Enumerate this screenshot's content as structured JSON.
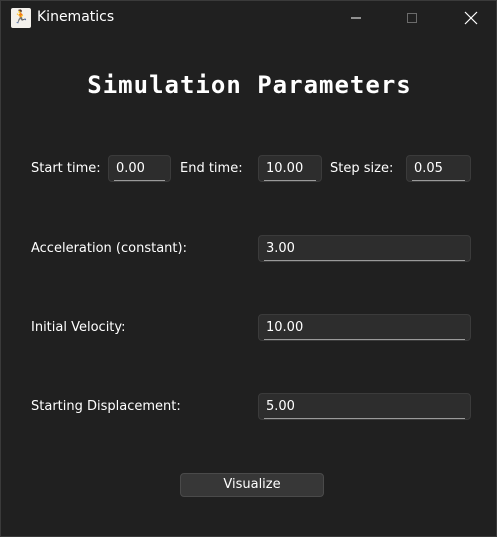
{
  "window": {
    "title": "Kinematics",
    "icon": "running-figure-icon"
  },
  "heading": "Simulation Parameters",
  "time": {
    "start_label": "Start time:",
    "start_value": "0.00",
    "end_label": "End time:",
    "end_value": "10.00",
    "step_label": "Step size:",
    "step_value": "0.05"
  },
  "acceleration": {
    "label": "Acceleration (constant):",
    "value": "3.00"
  },
  "velocity": {
    "label": "Initial Velocity:",
    "value": "10.00"
  },
  "displacement": {
    "label": "Starting Displacement:",
    "value": "5.00"
  },
  "actions": {
    "visualize_label": "Visualize"
  }
}
